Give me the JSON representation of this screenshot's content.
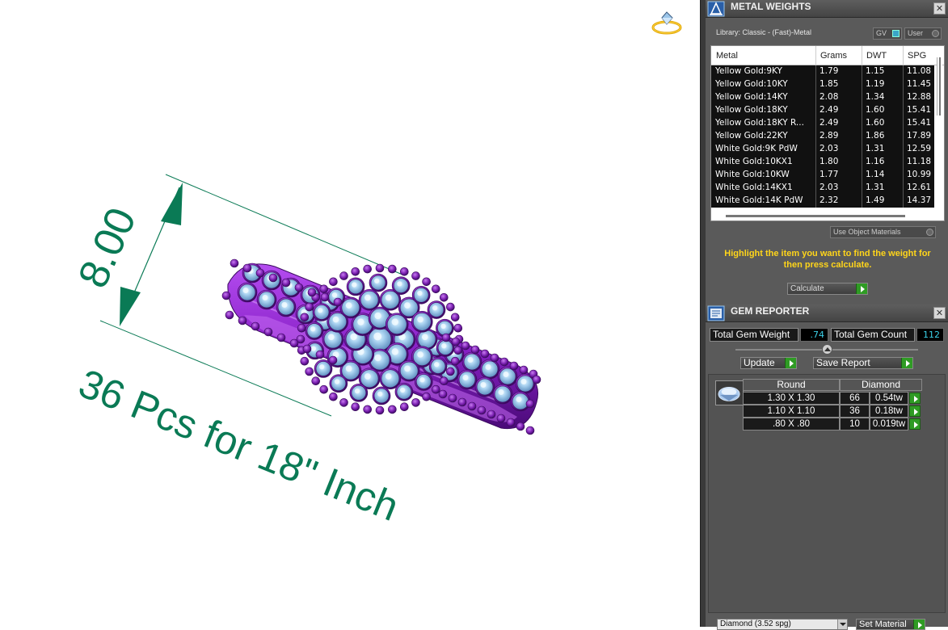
{
  "viewport": {
    "dimension_value": "8.00",
    "annotation": "36 Pcs for 18\" Inch"
  },
  "metal_weights": {
    "title": "METAL WEIGHTS",
    "library_label": "Library: Classic - (Fast)-Metal",
    "toggle_gv": "GV",
    "toggle_user": "User",
    "columns": [
      "Metal",
      "Grams",
      "DWT",
      "SPG"
    ],
    "rows": [
      {
        "metal": "Yellow Gold:9KY",
        "grams": "1.79",
        "dwt": "1.15",
        "spg": "11.08"
      },
      {
        "metal": "Yellow Gold:10KY",
        "grams": "1.85",
        "dwt": "1.19",
        "spg": "11.45"
      },
      {
        "metal": "Yellow Gold:14KY",
        "grams": "2.08",
        "dwt": "1.34",
        "spg": "12.88"
      },
      {
        "metal": "Yellow Gold:18KY",
        "grams": "2.49",
        "dwt": "1.60",
        "spg": "15.41"
      },
      {
        "metal": "Yellow Gold:18KY R...",
        "grams": "2.49",
        "dwt": "1.60",
        "spg": "15.41"
      },
      {
        "metal": "Yellow Gold:22KY",
        "grams": "2.89",
        "dwt": "1.86",
        "spg": "17.89"
      },
      {
        "metal": "White Gold:9K PdW",
        "grams": "2.03",
        "dwt": "1.31",
        "spg": "12.59"
      },
      {
        "metal": "White Gold:10KX1",
        "grams": "1.80",
        "dwt": "1.16",
        "spg": "11.18"
      },
      {
        "metal": "White Gold:10KW",
        "grams": "1.77",
        "dwt": "1.14",
        "spg": "10.99"
      },
      {
        "metal": "White Gold:14KX1",
        "grams": "2.03",
        "dwt": "1.31",
        "spg": "12.61"
      },
      {
        "metal": "White Gold:14K PdW",
        "grams": "2.32",
        "dwt": "1.49",
        "spg": "14.37"
      }
    ],
    "use_object_materials": "Use Object Materials",
    "hint": "Highlight the item you want to find the weight for then press calculate.",
    "calculate_label": "Calculate"
  },
  "gem_reporter": {
    "title": "GEM REPORTER",
    "total_weight_label": "Total Gem Weight",
    "total_weight_value": ".74",
    "total_count_label": "Total Gem Count",
    "total_count_value": "112",
    "update_label": "Update",
    "save_report_label": "Save Report",
    "shape_header": "Round",
    "material_header": "Diamond",
    "gems": [
      {
        "size": "1.30 X 1.30",
        "count": "66",
        "weight": "0.54tw"
      },
      {
        "size": "1.10 X 1.10",
        "count": "36",
        "weight": "0.18tw"
      },
      {
        "size": ".80 X .80",
        "count": "10",
        "weight": "0.019tw"
      }
    ],
    "material_select": "Diamond      (3.52 spg)",
    "set_material_label": "Set Material"
  },
  "colors": {
    "dimension_green": "#0a7a55",
    "metal_purple": "#7a1fb0",
    "gem_blue": "#9cc6ea",
    "hint_yellow": "#ffd51a",
    "play_green": "#2f9b24"
  }
}
